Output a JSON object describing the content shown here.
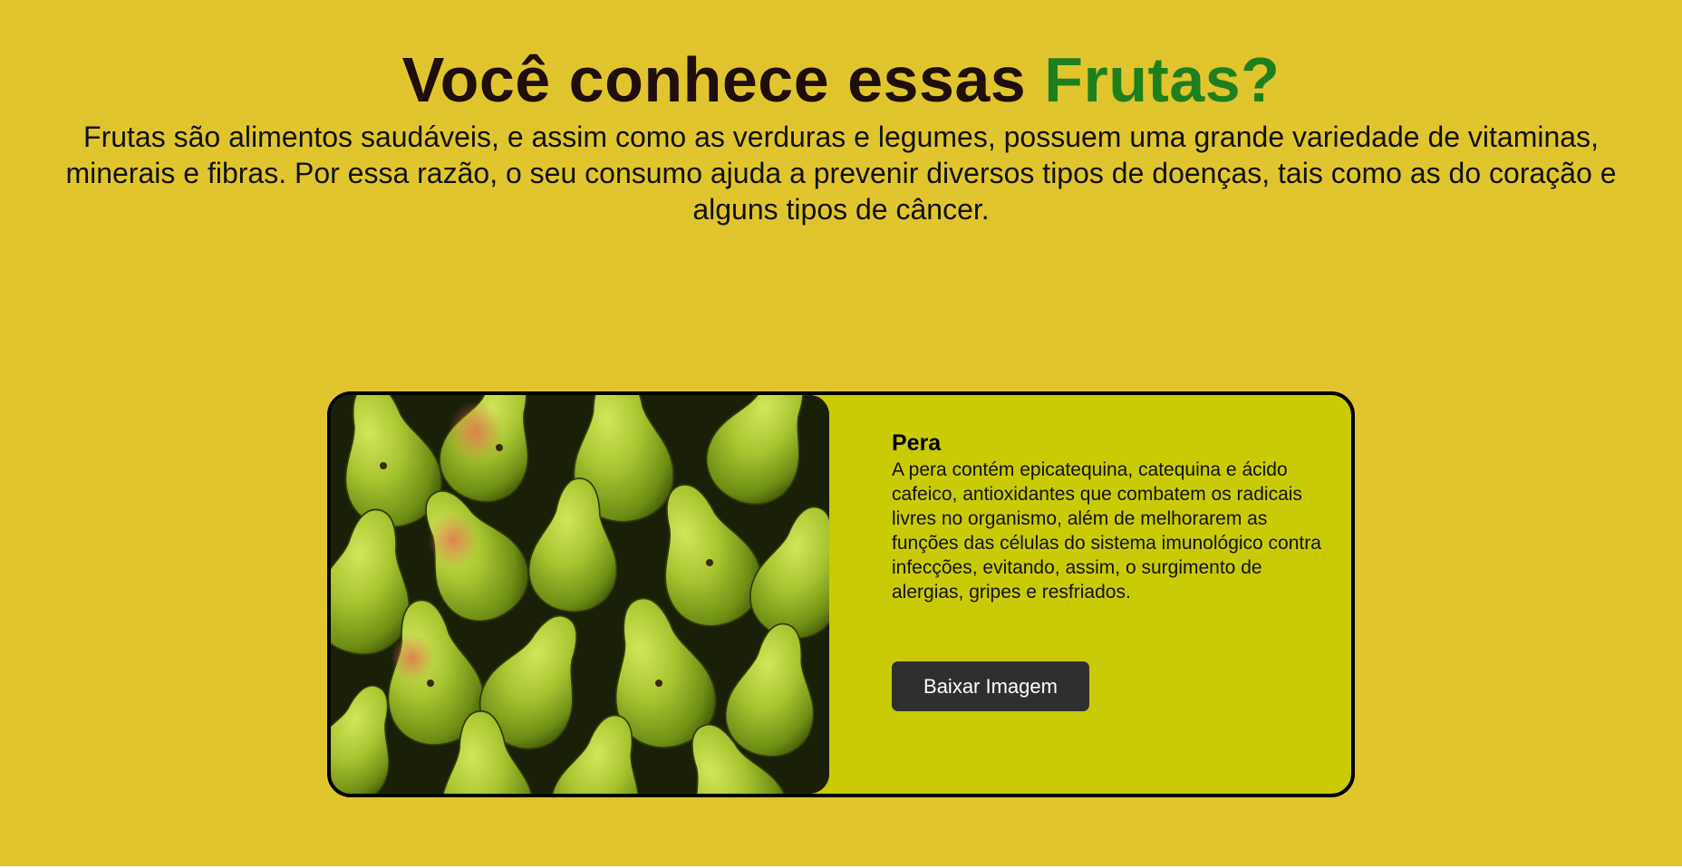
{
  "header": {
    "title_main": "Você conhece essas",
    "title_accent": "Frutas?",
    "intro": "Frutas são alimentos saudáveis, e assim como as verduras e legumes, possuem uma grande variedade de vitaminas, minerais e fibras. Por essa razão, o seu consumo ajuda a prevenir diversos tipos de doenças, tais como as do coração e alguns tipos de câncer."
  },
  "card": {
    "name": "Pera",
    "description": "A pera contém epicatequina, catequina e ácido cafeico, antioxidantes que combatem os radicais livres no organismo, além de melhorarem as funções das células do sistema imunológico contra infecções, evitando, assim, o surgimento de alergias, gripes e resfriados.",
    "button_label": "Baixar Imagem",
    "image_subject": "pile of green pears"
  },
  "colors": {
    "background": "#e0c52e",
    "title_accent": "#1e7f1d",
    "card_background": "#c8cb06",
    "button_background": "#2f2f2f"
  }
}
